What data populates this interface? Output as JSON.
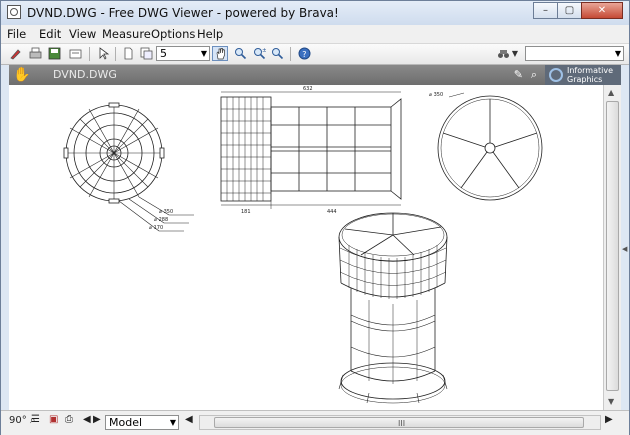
{
  "window": {
    "title": "DVND.DWG - Free DWG Viewer - powered by Brava!",
    "controls": [
      "–",
      "▢",
      "✕"
    ]
  },
  "menu": [
    "File",
    "Edit",
    "View",
    "Measure",
    "Options",
    "Help"
  ],
  "toolbar": {
    "page_number": "5",
    "right_combo_value": ""
  },
  "viewer": {
    "document_tab": "DVND.DWG",
    "brand_line1": "Informative",
    "brand_line2": "Graphics"
  },
  "drawing": {
    "top_dim": "632",
    "dim_left_bottom": "181",
    "dim_mid_bottom": "444",
    "left_dims": [
      "⌀ 350",
      "⌀ 288",
      "⌀ 170"
    ],
    "right_dim": "⌀ 350"
  },
  "status": {
    "rotation": "90°",
    "layout_tab": "Model",
    "scroll_grip": "III"
  },
  "colors": {
    "title_bg": "#d9e4f2",
    "viewer_header": "#7b7b7b",
    "canvas": "#ffffff"
  }
}
